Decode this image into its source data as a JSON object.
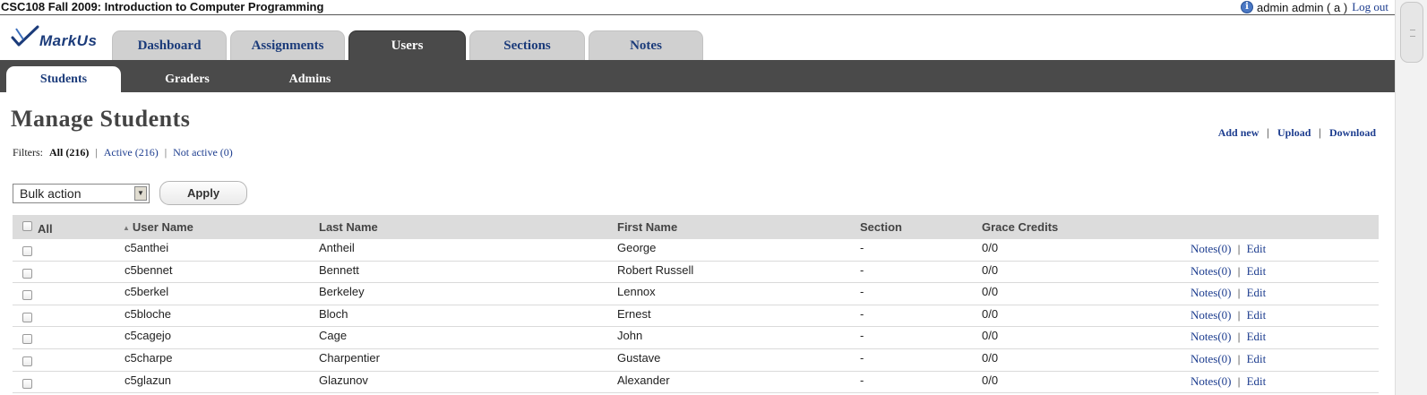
{
  "top": {
    "course_title": "CSC108 Fall 2009: Introduction to Computer Programming",
    "user_label": "admin admin",
    "user_role_open": " ( ",
    "user_role": "a",
    "user_role_close": " )",
    "logout": "Log out"
  },
  "logo": {
    "text": "MarkUs"
  },
  "main_tabs": [
    {
      "label": "Dashboard",
      "active": false
    },
    {
      "label": "Assignments",
      "active": false
    },
    {
      "label": "Users",
      "active": true
    },
    {
      "label": "Sections",
      "active": false
    },
    {
      "label": "Notes",
      "active": false
    }
  ],
  "sub_tabs": [
    {
      "label": "Students",
      "active": true
    },
    {
      "label": "Graders",
      "active": false
    },
    {
      "label": "Admins",
      "active": false
    }
  ],
  "page": {
    "title": "Manage Students",
    "actions": {
      "add_new": "Add new",
      "upload": "Upload",
      "download": "Download",
      "separator": "|"
    },
    "filters": {
      "label": "Filters:",
      "all": "All (216)",
      "active": "Active (216)",
      "not_active": "Not active (0)",
      "separator": "|"
    },
    "bulk": {
      "selected": "Bulk action",
      "apply": "Apply"
    }
  },
  "table": {
    "headers": {
      "select_all": "All",
      "user_name": "User Name",
      "last_name": "Last Name",
      "first_name": "First Name",
      "section": "Section",
      "grace_credits": "Grace Credits"
    },
    "rows": [
      {
        "user_name": "c5anthei",
        "last_name": "Antheil",
        "first_name": "George",
        "section": "-",
        "grace": "0/0",
        "notes": "Notes(0)",
        "sep": "|",
        "edit": "Edit"
      },
      {
        "user_name": "c5bennet",
        "last_name": "Bennett",
        "first_name": "Robert Russell",
        "section": "-",
        "grace": "0/0",
        "notes": "Notes(0)",
        "sep": "|",
        "edit": "Edit"
      },
      {
        "user_name": "c5berkel",
        "last_name": "Berkeley",
        "first_name": "Lennox",
        "section": "-",
        "grace": "0/0",
        "notes": "Notes(0)",
        "sep": "|",
        "edit": "Edit"
      },
      {
        "user_name": "c5bloche",
        "last_name": "Bloch",
        "first_name": "Ernest",
        "section": "-",
        "grace": "0/0",
        "notes": "Notes(0)",
        "sep": "|",
        "edit": "Edit"
      },
      {
        "user_name": "c5cagejo",
        "last_name": "Cage",
        "first_name": "John",
        "section": "-",
        "grace": "0/0",
        "notes": "Notes(0)",
        "sep": "|",
        "edit": "Edit"
      },
      {
        "user_name": "c5charpe",
        "last_name": "Charpentier",
        "first_name": "Gustave",
        "section": "-",
        "grace": "0/0",
        "notes": "Notes(0)",
        "sep": "|",
        "edit": "Edit"
      },
      {
        "user_name": "c5glazun",
        "last_name": "Glazunov",
        "first_name": "Alexander",
        "section": "-",
        "grace": "0/0",
        "notes": "Notes(0)",
        "sep": "|",
        "edit": "Edit"
      }
    ]
  },
  "icons": {
    "info": "info-icon",
    "sort": "sort-ascending-icon",
    "dropdown": "chevron-down-icon",
    "logo_check": "checkmark-logo-icon"
  },
  "colors": {
    "link": "#1d3d8f",
    "nav_dark": "#4a4a4a",
    "tab_inactive": "#d0d0d0",
    "header_row": "#dcdcdc"
  }
}
